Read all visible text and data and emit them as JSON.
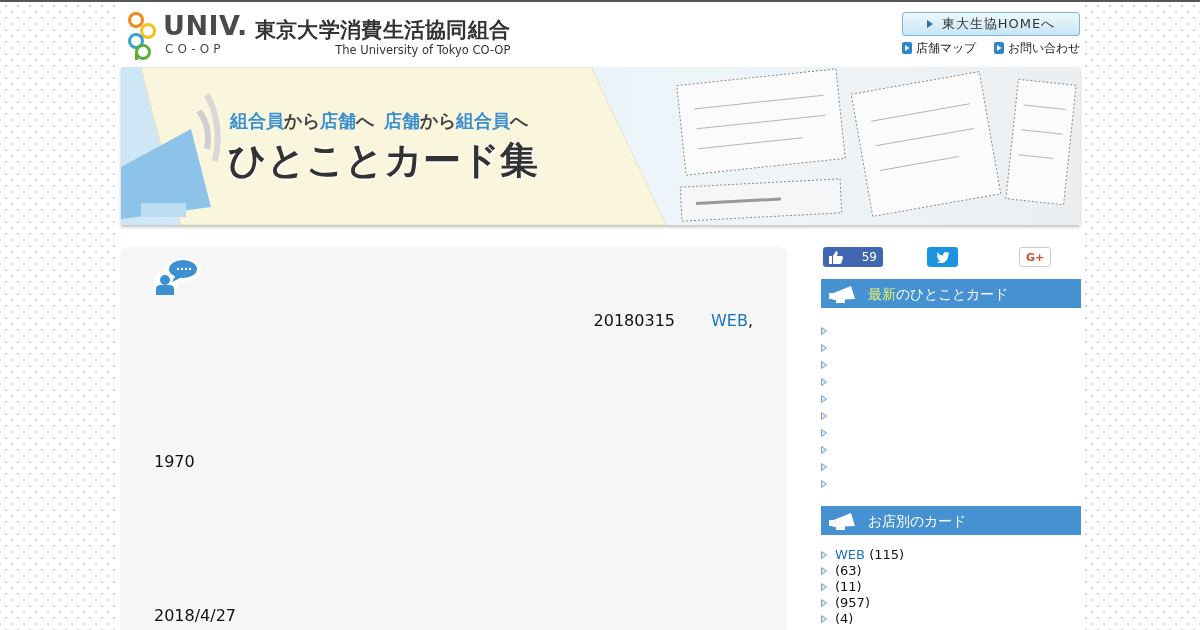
{
  "header": {
    "logo": {
      "wordmark": "UNIV.",
      "sub": "CO-OP",
      "name_ja": "東京大学消費生活協同組合",
      "name_en": "The University of Tokyo CO-OP"
    },
    "home_button": "東大生協HOMEへ",
    "links": [
      "店舗マップ",
      "お問い合わせ"
    ]
  },
  "banner": {
    "subtitle": [
      {
        "parts": [
          {
            "text": "組合員",
            "highlight": true
          },
          {
            "text": "から",
            "highlight": false
          },
          {
            "text": "店舗",
            "highlight": true
          },
          {
            "text": "へ",
            "highlight": false
          }
        ]
      },
      {
        "parts": [
          {
            "text": "店舗",
            "highlight": true
          },
          {
            "text": "から",
            "highlight": false
          },
          {
            "text": "組合員",
            "highlight": true
          },
          {
            "text": "へ",
            "highlight": false
          }
        ]
      }
    ],
    "title": "ひとことカード集"
  },
  "card": {
    "date": "20180315",
    "shop_link": "WEB",
    "separator": ",",
    "year": "1970",
    "posted": "2018/4/27"
  },
  "sidebar": {
    "social": {
      "like_count": "59",
      "gplus": "G+"
    },
    "latest": {
      "title": [
        {
          "text": "最新",
          "highlight": true
        },
        {
          "text": "のひとことカード",
          "highlight": false
        }
      ]
    },
    "shops": {
      "title": "お店別のカード",
      "items": [
        {
          "name": "WEB",
          "count": "(115)"
        },
        {
          "count": "(63)"
        },
        {
          "count": "(11)"
        },
        {
          "count": "(957)"
        },
        {
          "count": "(4)"
        }
      ]
    }
  }
}
